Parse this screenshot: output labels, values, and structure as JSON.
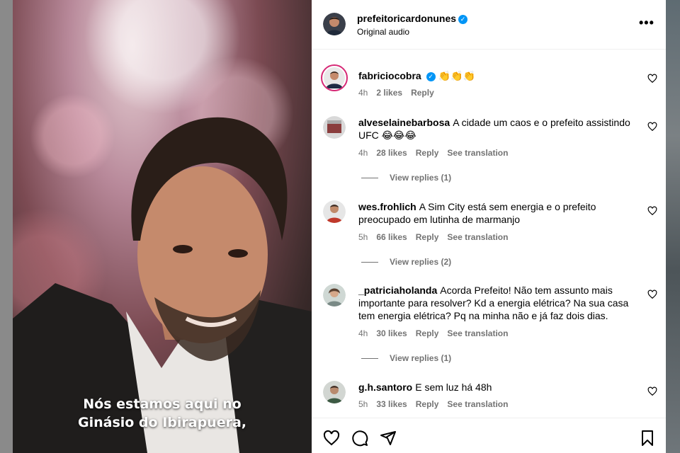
{
  "video": {
    "caption_line1": "Nós estamos aqui no",
    "caption_line2": "Ginásio do Ibirapuera,"
  },
  "post_header": {
    "username": "prefeitoricardonunes",
    "subtitle": "Original audio",
    "more_icon": "more-horizontal-icon"
  },
  "comments": [
    {
      "username": "fabriciocobra",
      "verified": true,
      "text": "👏👏👏",
      "time": "4h",
      "likes": "2 likes",
      "reply": "Reply"
    },
    {
      "username": "alveselainebarbosa",
      "text": "A cidade um caos e o prefeito assistindo UFC 😂😂😂",
      "time": "4h",
      "likes": "28 likes",
      "reply": "Reply",
      "see_translation": "See translation",
      "view_replies": "View replies (1)"
    },
    {
      "username": "wes.frohlich",
      "text": "A Sim City está sem energia e o prefeito preocupado em lutinha de marmanjo",
      "time": "5h",
      "likes": "66 likes",
      "reply": "Reply",
      "see_translation": "See translation",
      "view_replies": "View replies (2)"
    },
    {
      "username": "_patriciaholanda",
      "text": "Acorda Prefeito! Não tem assunto mais importante para resolver? Kd a energia elétrica? Na sua casa tem energia elétrica? Pq na minha não e já faz dois dias.",
      "time": "4h",
      "likes": "30 likes",
      "reply": "Reply",
      "see_translation": "See translation",
      "view_replies": "View replies (1)"
    },
    {
      "username": "g.h.santoro",
      "text": "E sem luz há 48h",
      "time": "5h",
      "likes": "33 likes",
      "reply": "Reply",
      "see_translation": "See translation"
    }
  ],
  "actions": {
    "like_icon": "heart-icon",
    "comment_icon": "comment-icon",
    "share_icon": "share-icon",
    "save_icon": "bookmark-icon"
  },
  "colors": {
    "verified": "#0095f6",
    "meta_text": "#737373"
  }
}
